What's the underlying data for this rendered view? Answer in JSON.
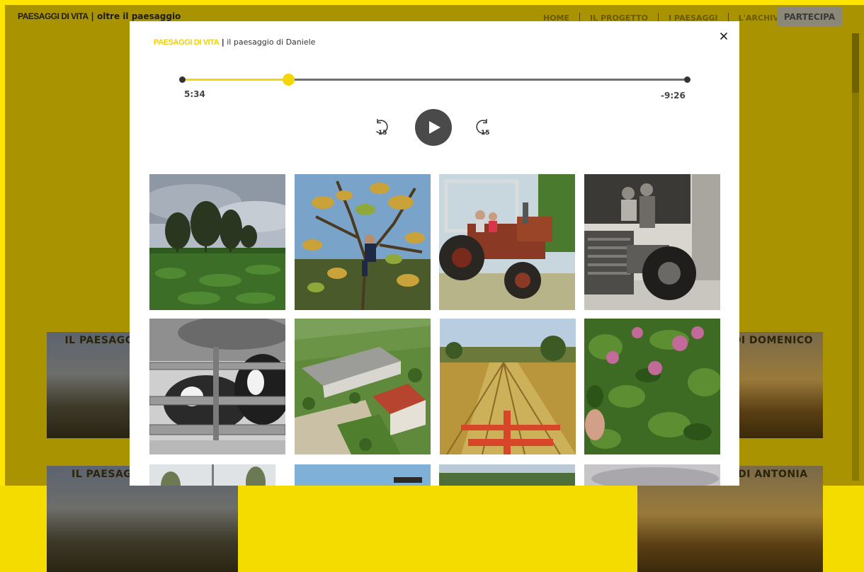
{
  "site": {
    "brand": "PAESAGGI DI VITA",
    "tagline": "| oltre il paesaggio"
  },
  "nav": {
    "items": [
      "HOME",
      "IL PROGETTO",
      "I PAESAGGI",
      "L'ARCHIVIO"
    ],
    "cta": "PARTECIPA"
  },
  "background_cards": [
    {
      "caption": "IL PAESAGGIO DI STEFANO"
    },
    {
      "caption": "IL PAESAGGIO DI DOMENICO"
    },
    {
      "caption": "IL PAESAGGIO DI GIULIA"
    },
    {
      "caption": "IL PAESAGGIO DI ANTONIA"
    }
  ],
  "modal": {
    "brand": "PAESAGGI DI VITA",
    "separator": "|",
    "subtitle": "il paesaggio di Daniele",
    "close_icon": "close-icon"
  },
  "player": {
    "elapsed": "5:34",
    "remaining": "-9:26",
    "progress_fraction": 0.21,
    "skip_back_label": "15",
    "skip_forward_label": "15",
    "accent_color": "#f4d70a",
    "track_color": "#6f6f6f",
    "play_button_color": "#4a4a4a",
    "icons": [
      "replay-15-icon",
      "play-icon",
      "forward-15-icon"
    ]
  },
  "gallery": {
    "photos": [
      "trees-field-photo",
      "man-in-tree-photo",
      "children-on-tractor-photo",
      "couple-on-tractor-bw-photo",
      "cows-fence-bw-photo",
      "farm-aerial-photo",
      "harvested-field-photo",
      "clover-flowers-photo",
      "photo-row3-1",
      "photo-row3-2",
      "photo-row3-3",
      "photo-row3-4"
    ]
  },
  "colors": {
    "frame_yellow": "#ffe600",
    "overlay_olive": "#aa9300",
    "brand_yellow": "#f4d000"
  }
}
